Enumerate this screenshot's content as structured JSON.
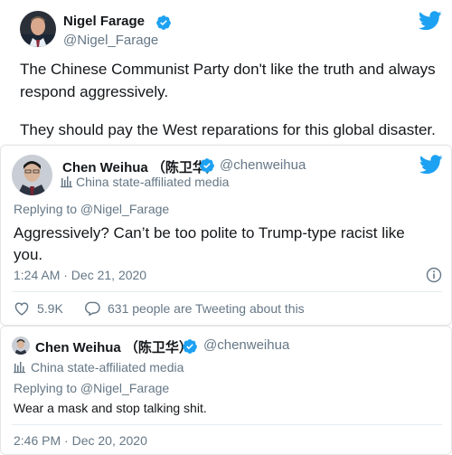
{
  "colors": {
    "accent": "#1da1f2",
    "muted": "#657786",
    "text": "#14171a",
    "border": "#e6ecf0"
  },
  "tweet1": {
    "name": "Nigel Farage",
    "handle": "@Nigel_Farage",
    "text_line1": "The Chinese Communist Party don't like the truth and always",
    "text_line2": "respond aggressively.",
    "text_line3": "They should pay the West reparations for this global disaster."
  },
  "tweet2": {
    "name": "Chen Weihua （陈卫华）",
    "handle": "@chenweihua",
    "affiliation": "China state-affiliated media",
    "replying_to": "Replying to @Nigel_Farage",
    "text_line1": "Aggressively? Can’t be too polite to Trump-type racist like",
    "text_line2": "you.",
    "timestamp": "1:24 AM · Dec 21, 2020",
    "likes": "5.9K",
    "tweeting_about": "631 people are Tweeting about this"
  },
  "tweet3": {
    "name": "Chen Weihua （陈卫华）",
    "handle": "@chenweihua",
    "affiliation": "China state-affiliated media",
    "replying_to": "Replying to @Nigel_Farage",
    "text": "Wear a mask and stop talking shit.",
    "timestamp": "2:46 PM · Dec 20, 2020"
  },
  "icons": [
    "twitter-bird-icon",
    "verified-badge-icon",
    "state-media-flag-icon",
    "info-icon",
    "heart-icon",
    "comment-icon"
  ]
}
